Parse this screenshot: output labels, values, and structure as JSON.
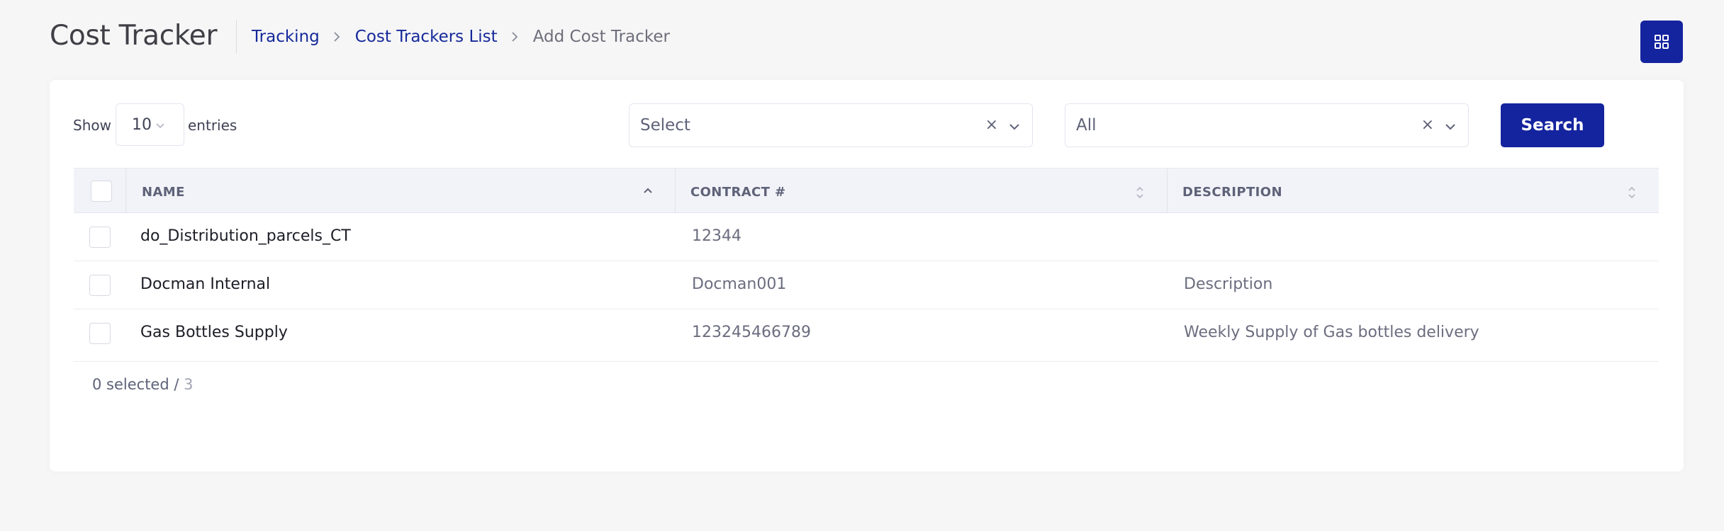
{
  "header": {
    "title": "Cost Tracker",
    "breadcrumb": [
      {
        "label": "Tracking",
        "link": true
      },
      {
        "label": "Cost Trackers List",
        "link": true
      },
      {
        "label": "Add Cost Tracker",
        "link": false
      }
    ],
    "grid_icon": "grid-icon"
  },
  "controls": {
    "show_label": "Show",
    "entries_value": "10",
    "entries_label": "entries",
    "filter1": {
      "value": "Select",
      "clear": "×"
    },
    "filter2": {
      "value": "All",
      "clear": "×"
    },
    "search_label": "Search"
  },
  "table": {
    "columns": [
      "NAME",
      "CONTRACT #",
      "DESCRIPTION"
    ],
    "rows": [
      {
        "name": "do_Distribution_parcels_CT",
        "contract": "12344",
        "description": ""
      },
      {
        "name": "Docman Internal",
        "contract": "Docman001",
        "description": "Description"
      },
      {
        "name": "Gas Bottles Supply",
        "contract": "123245466789",
        "description": "Weekly Supply of Gas bottles delivery"
      }
    ],
    "selected_text": "0 selected / ",
    "total": "3"
  },
  "colors": {
    "accent": "#14239e",
    "link": "#15299a",
    "background": "#f6f6f7"
  }
}
